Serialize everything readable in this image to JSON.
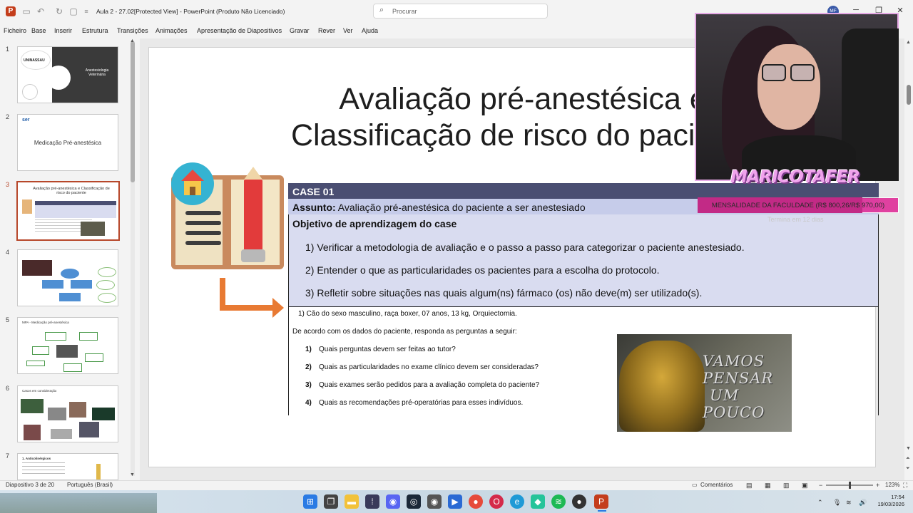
{
  "app": {
    "document_title": "Aula 2 - 27.02[Protected View]  -  PowerPoint (Produto Não Licenciado)",
    "search_placeholder": "Procurar",
    "user_initials": "MF"
  },
  "menu": [
    "Ficheiro",
    "Base",
    "Inserir",
    "Estrutura",
    "Transições",
    "Animações",
    "Apresentação de Diapositivos",
    "Gravar",
    "Rever",
    "Ver",
    "Ajuda"
  ],
  "thumbnails": [
    {
      "num": "1",
      "text": "Anestesiologia Veterinária",
      "brand": "UNINASSAU"
    },
    {
      "num": "2",
      "text": "Medicação Pré-anestésica",
      "brand": "ser"
    },
    {
      "num": "3",
      "text": "Avaliação pré-anestésica e Classificação de risco do paciente"
    },
    {
      "num": "4",
      "text": ""
    },
    {
      "num": "5",
      "text": "MPA - Medicação pré-anestésica"
    },
    {
      "num": "6",
      "text": "Casos em consideração"
    },
    {
      "num": "7",
      "text": "1. Anticolinérgicos"
    }
  ],
  "slide": {
    "title_line1": "Avaliação pré-anestésica e",
    "title_line2": "Classificação de risco do paciente",
    "case_header": "CASE 01",
    "subject_label": "Assunto:",
    "subject_text": " Avaliação pré-anestésica do paciente a ser anestesiado",
    "objective_title": "Objetivo de aprendizagem do case",
    "objectives": [
      "1)  Verificar a metodologia de avaliação e o passo a passo para categorizar o paciente anestesiado.",
      "2)  Entender o que as particularidades os pacientes para a escolha do protocolo.",
      "3)  Refletir sobre situações nas quais algum(ns) fármaco (os) não deve(m) ser utilizado(s)."
    ],
    "case_line": "1) Cão do sexo masculino, raça boxer, 07 anos, 13 kg, Orquiectomia.",
    "prompt": "De acordo com os dados do paciente, responda as perguntas a seguir:",
    "questions": [
      {
        "n": "1)",
        "t": "Quais perguntas devem ser feitas ao tutor?"
      },
      {
        "n": "2)",
        "t": "Quais as particularidades no exame clínico devem ser consideradas?"
      },
      {
        "n": "3)",
        "t": "Quais exames serão pedidos para a avaliação completa do paciente?"
      },
      {
        "n": "4)",
        "t": "Quais as recomendações pré-operatórias para esses indivíduos."
      }
    ],
    "image_text": [
      "VAMOS",
      "PENSAR",
      "UM",
      "POUCO"
    ]
  },
  "overlay": {
    "logo": "MARICOTAFER",
    "banner": "MENSALIDADE DA FACULDADE (R$ 800,26/R$ 970,00)",
    "banner_progress": 0.82,
    "banner_sub": "Termina em 12 dias"
  },
  "status": {
    "slide_info": "Diapositivo 3 de 20",
    "language": "Português (Brasil)",
    "comments": "Comentários",
    "zoom": "123%"
  },
  "taskbar": {
    "time": "17:54",
    "date": "19/03/2026"
  }
}
